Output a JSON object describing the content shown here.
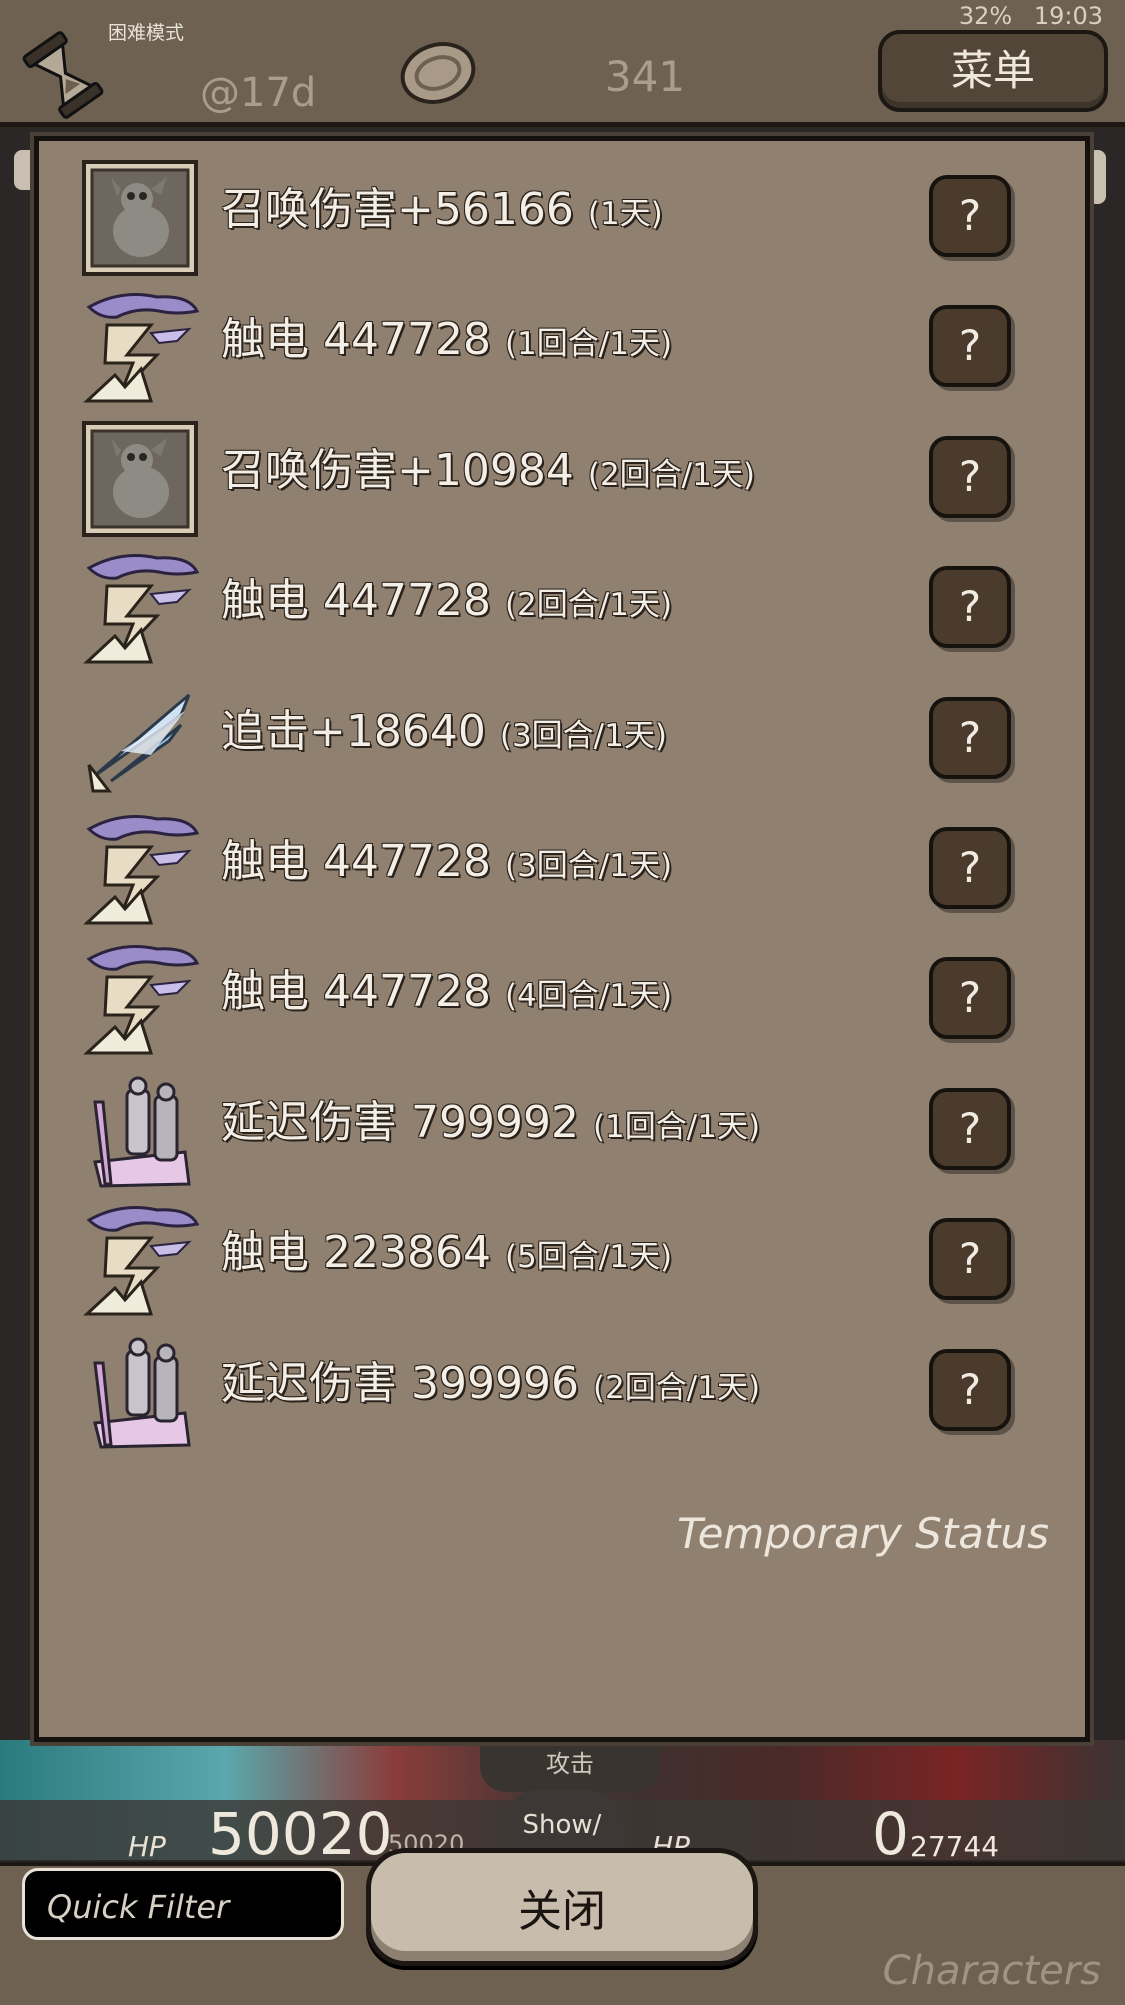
{
  "status_bar": {
    "battery": "32%",
    "time": "19:03"
  },
  "header": {
    "mode_label": "困难模式",
    "day": "@17d",
    "coins": "341",
    "menu_label": "菜单",
    "hourglass_icon": "hourglass-icon",
    "coin_icon": "coin-icon"
  },
  "panel": {
    "caption": "Temporary Status",
    "rows": [
      {
        "icon": "summon-icon",
        "name": "召唤伤害+56166",
        "duration": "(1天)",
        "help": "?"
      },
      {
        "icon": "lightning-icon",
        "name": "触电 447728",
        "duration": "(1回合/1天)",
        "help": "?"
      },
      {
        "icon": "summon-icon",
        "name": "召唤伤害+10984",
        "duration": "(2回合/1天)",
        "help": "?"
      },
      {
        "icon": "lightning-icon",
        "name": "触电 447728",
        "duration": "(2回合/1天)",
        "help": "?"
      },
      {
        "icon": "arrow-icon",
        "name": "追击+18640",
        "duration": "(3回合/1天)",
        "help": "?"
      },
      {
        "icon": "lightning-icon",
        "name": "触电 447728",
        "duration": "(3回合/1天)",
        "help": "?"
      },
      {
        "icon": "lightning-icon",
        "name": "触电 447728",
        "duration": "(4回合/1天)",
        "help": "?"
      },
      {
        "icon": "delay-icon",
        "name": "延迟伤害 799992",
        "duration": "(1回合/1天)",
        "help": "?"
      },
      {
        "icon": "lightning-icon",
        "name": "触电 223864",
        "duration": "(5回合/1天)",
        "help": "?"
      },
      {
        "icon": "delay-icon",
        "name": "延迟伤害 399996",
        "duration": "(2回合/1天)",
        "help": "?"
      }
    ]
  },
  "battle": {
    "attack_label": "攻击",
    "show_label": "Show/",
    "left_hp_label": "HP",
    "left_hp": "50020",
    "left_hp_max": "50020",
    "right_hp_label": "HP",
    "right_hp": "0",
    "right_hp_max": "27744"
  },
  "footer": {
    "filter_placeholder": "Quick Filter",
    "close_label": "关闭",
    "characters_label": "Characters"
  },
  "colors": {
    "panel_bg": "#8f806f",
    "bar_bg": "#6e6152",
    "button_dark": "#4b3b2c",
    "close_button": "#c8bdad"
  }
}
